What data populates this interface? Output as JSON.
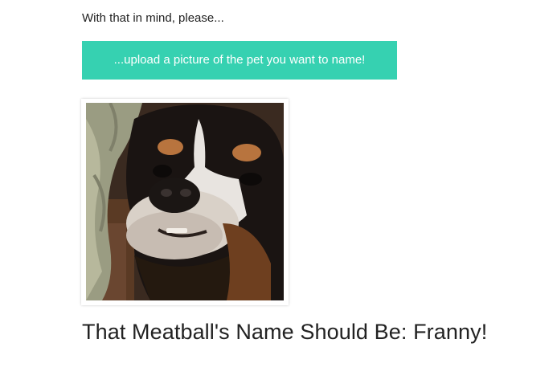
{
  "intro": {
    "text": "With that in mind, please..."
  },
  "upload": {
    "label": "...upload a picture of the pet you want to name!",
    "color": "#36d1b1",
    "text_color": "#ffffff"
  },
  "pet_photo": {
    "subject": "dog-photo-icon"
  },
  "result": {
    "text": "That Meatball's Name Should Be: Franny!"
  }
}
